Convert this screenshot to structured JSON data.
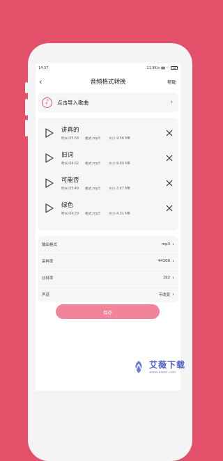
{
  "status": {
    "time": "14:37",
    "net": "11.9K/s",
    "battery": "48"
  },
  "nav": {
    "back_icon": "back-arrow-icon",
    "title": "音频格式转换",
    "help": "帮助"
  },
  "import": {
    "icon": "music-note-icon",
    "label": "点击导入歌曲"
  },
  "songs": [
    {
      "title": "讲真的",
      "duration": "时长:03:58",
      "format": "格式:mp3",
      "size": "大小:9.56 MB"
    },
    {
      "title": "旧词",
      "duration": "时长:04:02",
      "format": "格式:mp3",
      "size": "大小:9.69 MB"
    },
    {
      "title": "可能否",
      "duration": "时长:03:49",
      "format": "格式:mp3",
      "size": "大小:3.67 MB"
    },
    {
      "title": "绿色",
      "duration": "时长:04:29",
      "format": "格式:mp3",
      "size": "大小:4.31 MB"
    }
  ],
  "settings": [
    {
      "label": "输出格式",
      "value": "mp3"
    },
    {
      "label": "采样率",
      "value": "44100"
    },
    {
      "label": "比特率",
      "value": "192"
    },
    {
      "label": "声道",
      "value": "不改变"
    }
  ],
  "save_label": "保存",
  "watermark": {
    "name": "艾薇下载",
    "url": "www.aiwei.com"
  },
  "colors": {
    "background": "#e3506a",
    "accent": "#e3506a",
    "save_button": "#f1839a"
  }
}
